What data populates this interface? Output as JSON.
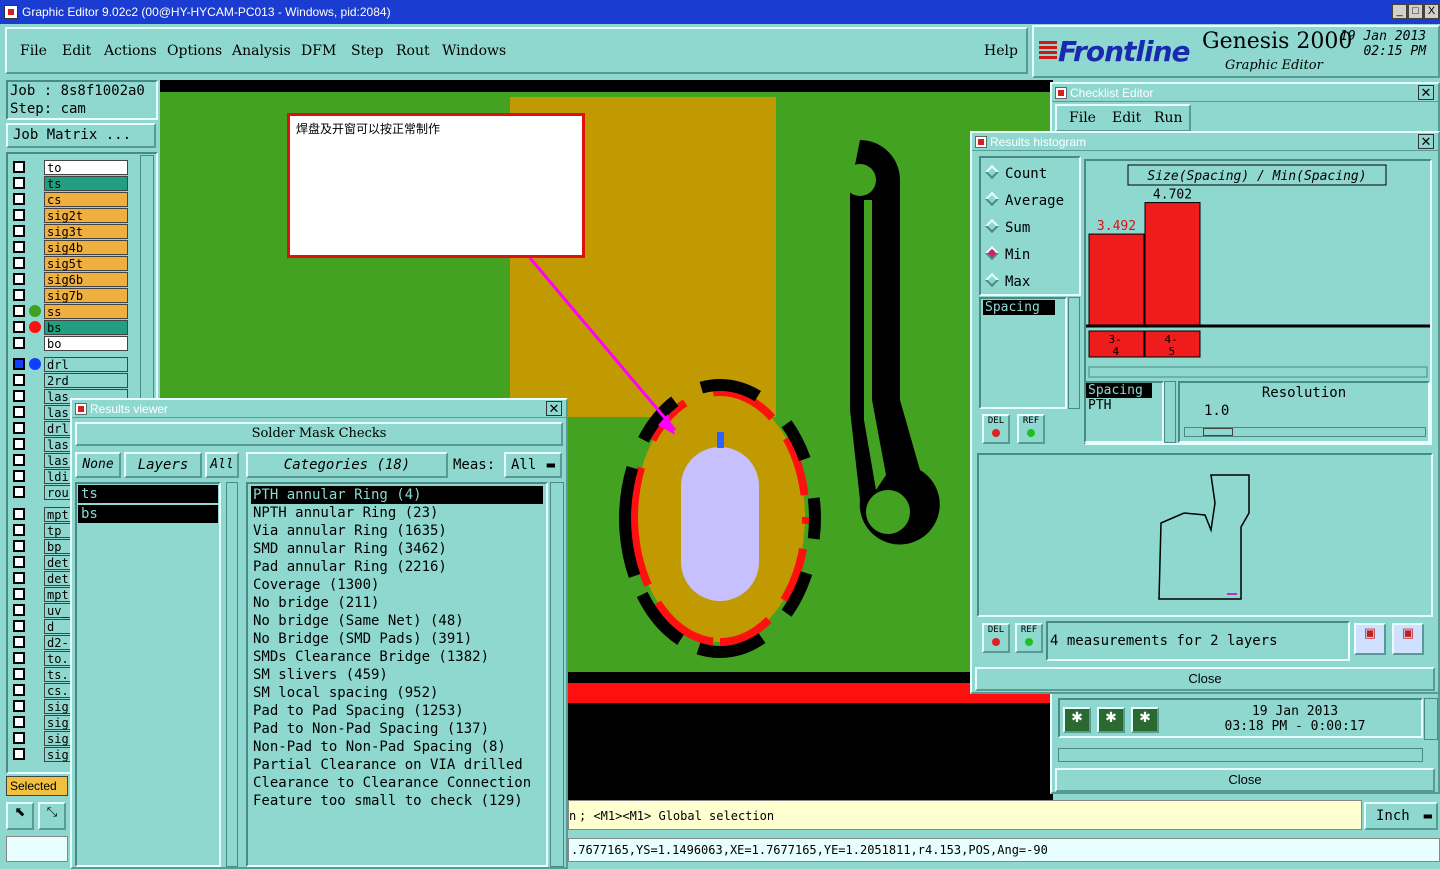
{
  "window": {
    "title": "Graphic Editor 9.02c2 (00@HY-HYCAM-PC013 - Windows, pid:2084)",
    "min": "_",
    "max": "□",
    "close": "X"
  },
  "menu": {
    "items": [
      "File",
      "Edit",
      "Actions",
      "Options",
      "Analysis",
      "DFM",
      "Step",
      "Rout",
      "Windows"
    ],
    "help": "Help"
  },
  "brand": {
    "logo": "Frontline",
    "product": "Genesis 2000",
    "subtitle": "Graphic Editor",
    "date": "19 Jan 2013",
    "time": "02:15 PM"
  },
  "job": {
    "job": "Job : 8s8f1002a0",
    "step": "Step: cam",
    "matrix_button": "Job Matrix ..."
  },
  "layers": [
    {
      "name": "to",
      "color": "#ffffff",
      "dot": ""
    },
    {
      "name": "ts",
      "color": "#20a080",
      "dot": ""
    },
    {
      "name": "cs",
      "color": "#f0b040",
      "dot": ""
    },
    {
      "name": "sig2t",
      "color": "#f0b040",
      "dot": ""
    },
    {
      "name": "sig3t",
      "color": "#f0b040",
      "dot": ""
    },
    {
      "name": "sig4b",
      "color": "#f0b040",
      "dot": ""
    },
    {
      "name": "sig5t",
      "color": "#f0b040",
      "dot": ""
    },
    {
      "name": "sig6b",
      "color": "#f0b040",
      "dot": ""
    },
    {
      "name": "sig7b",
      "color": "#f0b040",
      "dot": ""
    },
    {
      "name": "ss",
      "color": "#f0b040",
      "dot": "#40a020"
    },
    {
      "name": "bs",
      "color": "#20a080",
      "dot": "#ff1010"
    },
    {
      "name": "bo",
      "color": "#ffffff",
      "dot": ""
    },
    {
      "name": "drl",
      "color": "#8fd8d0",
      "dot": "#1040ff"
    },
    {
      "name": "2rd",
      "color": "#8fd8d0",
      "dot": ""
    },
    {
      "name": "las",
      "color": "#8fd8d0",
      "dot": ""
    },
    {
      "name": "las",
      "color": "#8fd8d0",
      "dot": ""
    },
    {
      "name": "drl",
      "color": "#8fd8d0",
      "dot": ""
    },
    {
      "name": "las",
      "color": "#8fd8d0",
      "dot": ""
    },
    {
      "name": "las",
      "color": "#8fd8d0",
      "dot": ""
    },
    {
      "name": "ldi",
      "color": "#8fd8d0",
      "dot": ""
    },
    {
      "name": "rou",
      "color": "#8fd8d0",
      "dot": ""
    },
    {
      "name": "mpt",
      "color": "#8fd8d0",
      "dot": ""
    },
    {
      "name": "tp",
      "color": "#8fd8d0",
      "dot": ""
    },
    {
      "name": "bp",
      "color": "#8fd8d0",
      "dot": ""
    },
    {
      "name": "det",
      "color": "#8fd8d0",
      "dot": ""
    },
    {
      "name": "det",
      "color": "#8fd8d0",
      "dot": ""
    },
    {
      "name": "mpt",
      "color": "#8fd8d0",
      "dot": ""
    },
    {
      "name": "uv_",
      "color": "#8fd8d0",
      "dot": ""
    },
    {
      "name": "d",
      "color": "#8fd8d0",
      "dot": ""
    },
    {
      "name": "d2-",
      "color": "#8fd8d0",
      "dot": ""
    },
    {
      "name": "to.",
      "color": "#8fd8d0",
      "dot": ""
    },
    {
      "name": "ts.",
      "color": "#8fd8d0",
      "dot": ""
    },
    {
      "name": "cs.",
      "color": "#8fd8d0",
      "dot": ""
    },
    {
      "name": "sig",
      "color": "#8fd8d0",
      "dot": ""
    },
    {
      "name": "sig",
      "color": "#8fd8d0",
      "dot": ""
    },
    {
      "name": "sig",
      "color": "#8fd8d0",
      "dot": ""
    },
    {
      "name": "sig",
      "color": "#8fd8d0",
      "dot": ""
    }
  ],
  "selected_label": "Selected",
  "annotation": {
    "text": "焊盘及开窗可以按正常制作"
  },
  "results_viewer": {
    "title": "Results viewer",
    "header": "Solder Mask Checks",
    "none": "None",
    "layers": "Layers",
    "all": "All",
    "categories": "Categories (18)",
    "meas": "Meas:",
    "meas_value": "All",
    "layer_list": [
      "ts",
      "bs"
    ],
    "category_list": [
      "PTH annular Ring (4)",
      "NPTH annular Ring (23)",
      "Via annular Ring (1635)",
      "SMD annular Ring (3462)",
      "Pad annular Ring (2216)",
      "Coverage (1300)",
      "No bridge (211)",
      "No bridge (Same Net) (48)",
      "No Bridge (SMD Pads) (391)",
      "SMDs Clearance Bridge (1382)",
      "SM slivers (459)",
      "SM local spacing (952)",
      "Pad to Pad Spacing (1253)",
      "Pad to Non-Pad Spacing (137)",
      "Non-Pad to Non-Pad Spacing (8)",
      "Partial Clearance on VIA drilled",
      "Clearance to Clearance Connection",
      "Feature too small to check (129)"
    ]
  },
  "checklist": {
    "title": "Checklist Editor",
    "menu": [
      "File",
      "Edit",
      "Run"
    ],
    "date": "19 Jan 2013",
    "time": "03:18 PM - 0:00:17",
    "close": "Close"
  },
  "histogram": {
    "title": "Results histogram",
    "modes": [
      "Count",
      "Average",
      "Sum",
      "Min",
      "Max"
    ],
    "selected_mode": "Min",
    "chart_title": "Size(Spacing) / Min(Spacing)",
    "spacing_item": "Spacing",
    "del": "DEL",
    "ref": "REF",
    "type_list": [
      "Spacing",
      "PTH"
    ],
    "resolution_label": "Resolution",
    "resolution_value": "1.0",
    "summary": "4 measurements for 2 layers",
    "close": "Close"
  },
  "chart_data": {
    "type": "bar",
    "categories": [
      "3-4",
      "4-5"
    ],
    "values": [
      3.492,
      4.702
    ],
    "title": "Size(Spacing) / Min(Spacing)",
    "bar_color": "#ee1c1c",
    "ylim": [
      0,
      5
    ]
  },
  "status": {
    "prompt": "; <M1><M1> Global selection",
    "prefix": "n",
    "units": "Inch",
    "coords": ".7677165,YS=1.1496063,XE=1.7677165,YE=1.2051811,r4.153,POS,Ang=-90"
  }
}
